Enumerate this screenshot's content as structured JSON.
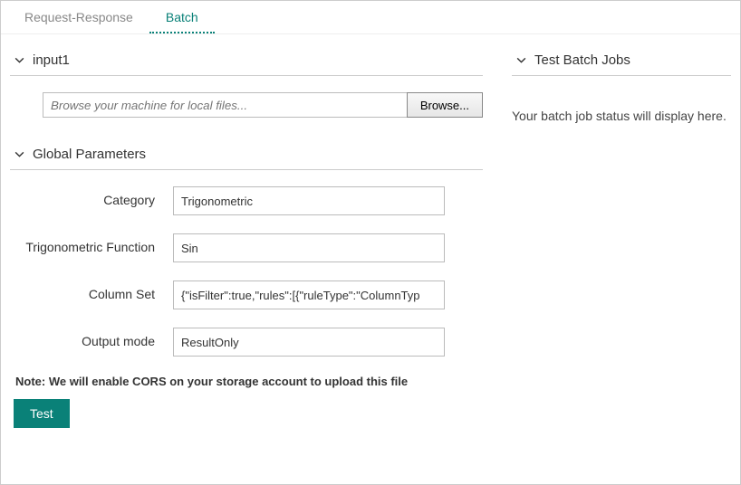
{
  "tabs": {
    "request_response": "Request-Response",
    "batch": "Batch"
  },
  "sections": {
    "input1": {
      "title": "input1"
    },
    "global_params": {
      "title": "Global Parameters"
    },
    "test_jobs": {
      "title": "Test Batch Jobs"
    }
  },
  "file": {
    "placeholder": "Browse your machine for local files...",
    "browse_label": "Browse..."
  },
  "params": {
    "category": {
      "label": "Category",
      "value": "Trigonometric"
    },
    "trig_func": {
      "label": "Trigonometric Function",
      "value": "Sin"
    },
    "column_set": {
      "label": "Column Set",
      "value": "{\"isFilter\":true,\"rules\":[{\"ruleType\":\"ColumnTyp"
    },
    "output_mode": {
      "label": "Output mode",
      "value": "ResultOnly"
    }
  },
  "note": "Note: We will enable CORS on your storage account to upload this file",
  "test_btn": "Test",
  "status": "Your batch job status will display here."
}
